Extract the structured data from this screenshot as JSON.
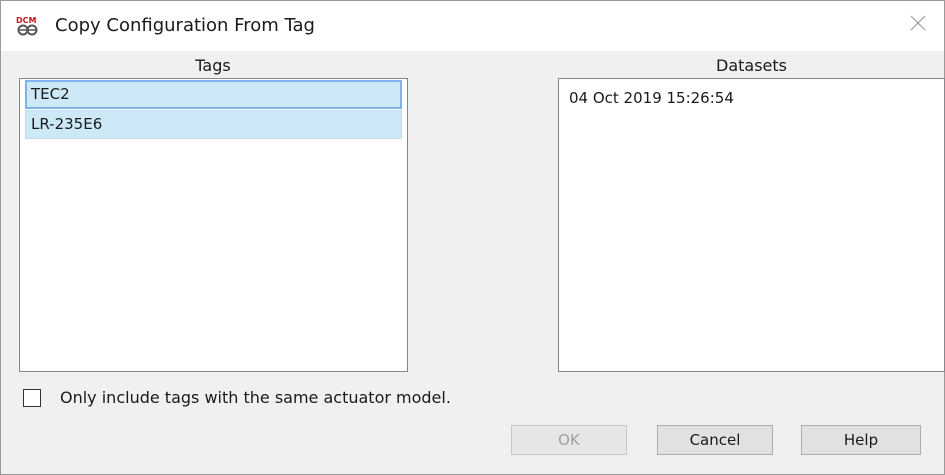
{
  "window": {
    "title": "Copy Configuration From Tag",
    "icon": "dcm-app-icon",
    "close_icon": "close-icon"
  },
  "tags": {
    "header": "Tags",
    "items": [
      "TEC2",
      "LR-235E6"
    ]
  },
  "datasets": {
    "header": "Datasets",
    "items": [
      "04 Oct 2019 15:26:54"
    ]
  },
  "filter": {
    "label": "Only include tags with the same actuator model.",
    "checked": false
  },
  "buttons": {
    "ok": "OK",
    "cancel": "Cancel",
    "help": "Help"
  },
  "colors": {
    "selection": "#cde8f7",
    "focus_border": "#7eb4ea",
    "dialog_bg": "#f0f0f0",
    "icon_red": "#c4161c"
  }
}
